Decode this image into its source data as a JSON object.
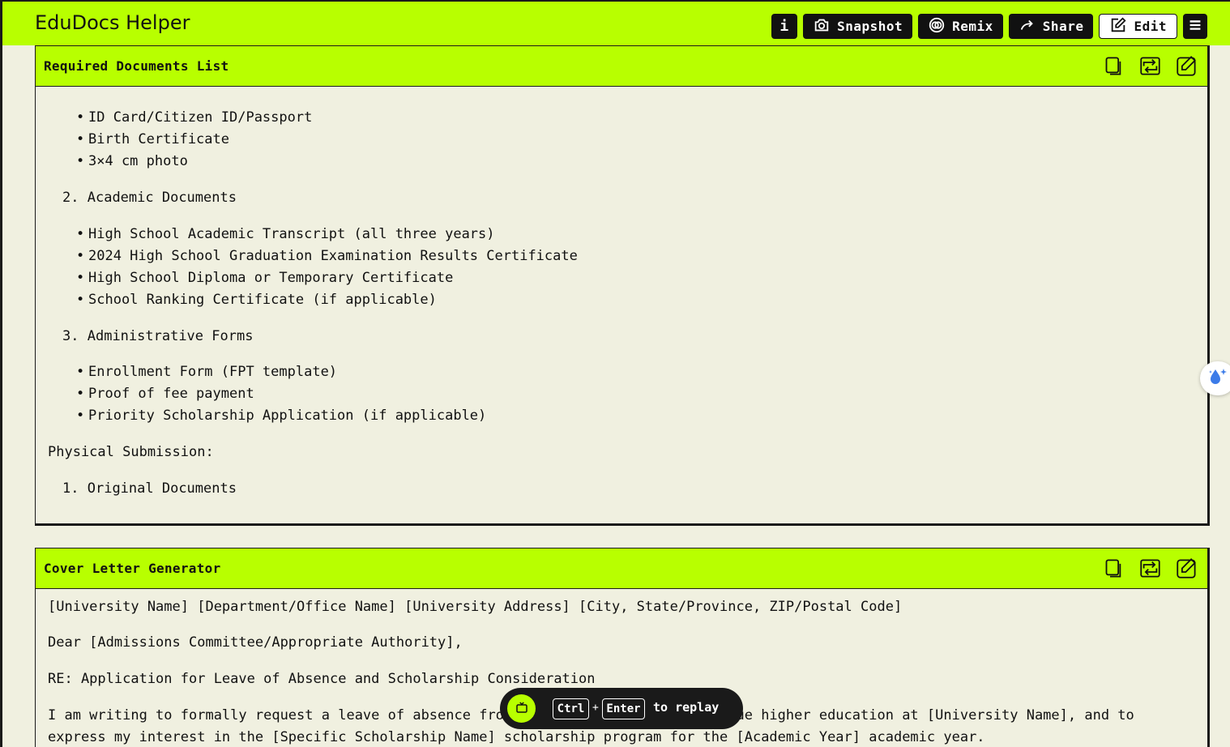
{
  "app": {
    "title": "EduDocs Helper"
  },
  "toolbar": {
    "info_label": "i",
    "snapshot_label": "Snapshot",
    "remix_label": "Remix",
    "share_label": "Share",
    "edit_label": "Edit"
  },
  "cards": [
    {
      "title": "Required Documents List",
      "group1_items": [
        "ID Card/Citizen ID/Passport",
        "Birth Certificate",
        "3×4 cm photo"
      ],
      "section2": {
        "num": "2.",
        "label": "Academic Documents"
      },
      "group2_items": [
        "High School Academic Transcript (all three years)",
        "2024 High School Graduation Examination Results Certificate",
        "High School Diploma or Temporary Certificate",
        "School Ranking Certificate (if applicable)"
      ],
      "section3": {
        "num": "3.",
        "label": "Administrative Forms"
      },
      "group3_items": [
        "Enrollment Form (FPT template)",
        "Proof of fee payment",
        "Priority Scholarship Application (if applicable)"
      ],
      "physical_heading": "Physical Submission:",
      "section_p1": {
        "num": "1.",
        "label": "Original Documents"
      }
    },
    {
      "title": "Cover Letter Generator",
      "address_line": "[University Name] [Department/Office Name] [University Address] [City, State/Province, ZIP/Postal Code]",
      "salutation": "Dear [Admissions Committee/Appropriate Authority],",
      "subject": "RE: Application for Leave of Absence and Scholarship Consideration",
      "body_line1": "I am writing to formally request a leave of absence from my current studies to pursue higher education at [University Name], and to",
      "body_line2": "express my interest in the [Specific Scholarship Name] scholarship program for the [Academic Year] academic year."
    }
  ],
  "replay": {
    "ctrl_key": "Ctrl",
    "plus": "+",
    "enter_key": "Enter",
    "text": "to replay"
  },
  "colors": {
    "accent": "#b8ff00",
    "background": "#f0f0e0",
    "dark": "#1a1a1a"
  }
}
